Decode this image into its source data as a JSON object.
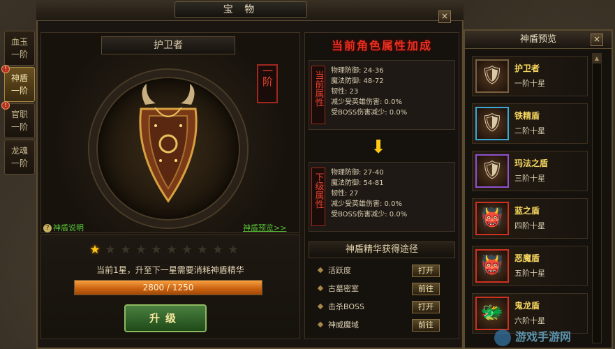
{
  "window": {
    "title": "宝 物",
    "close": "×"
  },
  "tabs": [
    {
      "line1": "血玉",
      "line2": "一阶",
      "active": false,
      "alert": false
    },
    {
      "line1": "神盾",
      "line2": "一阶",
      "active": true,
      "alert": true
    },
    {
      "line1": "官职",
      "line2": "一阶",
      "active": false,
      "alert": true
    },
    {
      "line1": "龙魂",
      "line2": "一阶",
      "active": false,
      "alert": false
    }
  ],
  "item": {
    "name": "护卫者",
    "rank": "一阶",
    "explain_link": "神盾说明",
    "preview_link": "神盾预览>>",
    "stars_total": 10,
    "stars_on": 1,
    "upgrade_hint": "当前1星，升至下一星需要消耗神盾精华",
    "progress_text": "2800 / 1250",
    "progress_fraction": 1.0,
    "upgrade_label": "升级"
  },
  "attrs": {
    "title": "当前角色属性加成",
    "current": {
      "label": "当前属性",
      "lines": [
        "物理防御: 24-36",
        "魔法防御: 48-72",
        "韧性: 23",
        "减少受英雄伤害: 0.0%",
        "受BOSS伤害减少: 0.0%"
      ]
    },
    "next": {
      "label": "下级属性",
      "lines": [
        "物理防御: 27-40",
        "魔法防御: 54-81",
        "韧性: 27",
        "减少受英雄伤害: 0.0%",
        "受BOSS伤害减少: 0.0%"
      ]
    }
  },
  "ways": {
    "title": "神盾精华获得途径",
    "items": [
      {
        "name": "活跃度",
        "button": "打开"
      },
      {
        "name": "古墓密室",
        "button": "前往"
      },
      {
        "name": "击杀BOSS",
        "button": "打开"
      },
      {
        "name": "神威魔域",
        "button": "前往"
      }
    ]
  },
  "preview": {
    "title": "神盾预览",
    "close": "×",
    "items": [
      {
        "name": "护卫者",
        "sub": "一阶十星",
        "border": "#7a6040"
      },
      {
        "name": "铁精盾",
        "sub": "二阶十星",
        "border": "#3aa8d8"
      },
      {
        "name": "玛法之盾",
        "sub": "三阶十星",
        "border": "#9050d0"
      },
      {
        "name": "蓝之盾",
        "sub": "四阶十星",
        "border": "#d03020"
      },
      {
        "name": "恶魔盾",
        "sub": "五阶十星",
        "border": "#d03020"
      },
      {
        "name": "鬼龙盾",
        "sub": "六阶十星",
        "border": "#d03020"
      }
    ]
  },
  "watermark": "游戏手游网"
}
